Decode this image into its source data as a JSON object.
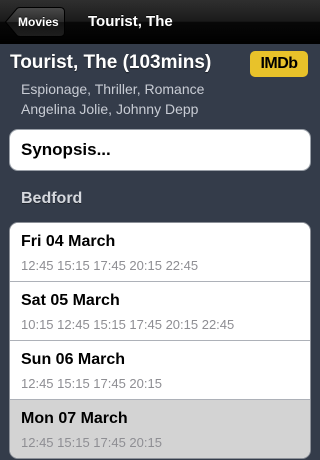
{
  "navbar": {
    "back_label": "Movies",
    "title": "Tourist, The"
  },
  "movie": {
    "title": "Tourist, The (103mins)",
    "imdb_label": "IMDb",
    "genres": "Espionage,  Thriller,  Romance",
    "cast": "Angelina Jolie,  Johnny Depp"
  },
  "synopsis": {
    "label": "Synopsis..."
  },
  "cinema": {
    "name": "Bedford",
    "days": [
      {
        "label": "Fri 04 March",
        "times": "12:45  15:15  17:45  20:15  22:45",
        "selected": false
      },
      {
        "label": "Sat 05 March",
        "times": "10:15  12:45  15:15  17:45  20:15  22:45",
        "selected": false
      },
      {
        "label": "Sun 06 March",
        "times": "12:45  15:15  17:45  20:15",
        "selected": false
      },
      {
        "label": "Mon 07 March",
        "times": "12:45  15:15  17:45  20:15",
        "selected": true
      }
    ]
  },
  "colors": {
    "background": "#343c4a",
    "imdb_yellow": "#e8c22a",
    "selected_row": "#d3d3d3"
  }
}
